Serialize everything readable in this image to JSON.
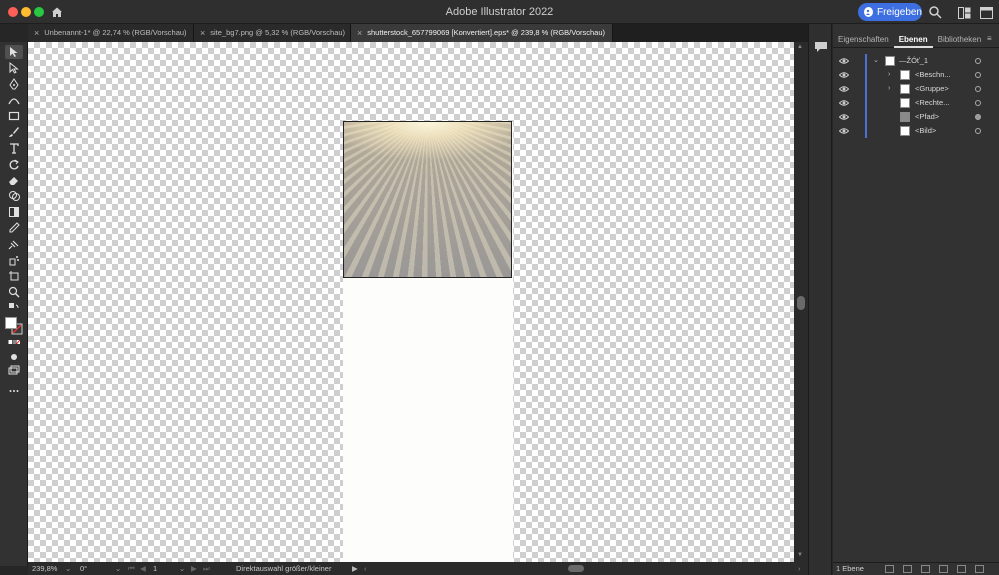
{
  "app": {
    "title": "Adobe Illustrator 2022",
    "share_label": "Freigeben"
  },
  "tabs": [
    {
      "label": "Unbenannt-1* @ 22,74 % (RGB/Vorschau)",
      "active": false
    },
    {
      "label": "site_bg7.png @ 5,32 % (RGB/Vorschau)",
      "active": false
    },
    {
      "label": "shutterstock_657799069 [Konvertiert].eps* @ 239,8 % (RGB/Vorschau)",
      "active": true
    }
  ],
  "tab_close_glyph": "×",
  "tools": [
    "selection-tool",
    "direct-selection-tool",
    "pen-tool",
    "curvature-tool",
    "rectangle-tool",
    "paintbrush-tool",
    "type-tool",
    "rotate-tool",
    "eraser-tool",
    "shape-builder-tool",
    "gradient-tool",
    "eyedropper-tool",
    "blend-tool",
    "symbol-sprayer-tool",
    "artboard-tool",
    "zoom-tool"
  ],
  "panel": {
    "tabs": [
      "Eigenschaften",
      "Ebenen",
      "Bibliotheken"
    ],
    "active_tab": "Ebenen",
    "menu_glyph": "≡",
    "layers": [
      {
        "name": "—ŽÓť_1",
        "expanded": true,
        "indent": 0,
        "target_filled": false
      },
      {
        "name": "<Beschn...",
        "expanded": false,
        "indent": 1,
        "has_chevron": true,
        "target_filled": false
      },
      {
        "name": "<Gruppe>",
        "expanded": false,
        "indent": 1,
        "has_chevron": true,
        "target_filled": false
      },
      {
        "name": "<Rechte...",
        "indent": 1,
        "has_chevron": false,
        "target_filled": false
      },
      {
        "name": "<Pfad>",
        "indent": 1,
        "has_chevron": false,
        "target_filled": true
      },
      {
        "name": "<Bild>",
        "indent": 1,
        "has_chevron": false,
        "target_filled": false
      }
    ],
    "layer_count": "1 Ebene"
  },
  "status": {
    "zoom": "239,8%",
    "rotation": "0°",
    "artboard": "1",
    "tool_hint": "Direktauswahl größer/kleiner"
  },
  "colors": {
    "accent": "#3e6fe0",
    "layer_color": "#4b6fd6"
  }
}
